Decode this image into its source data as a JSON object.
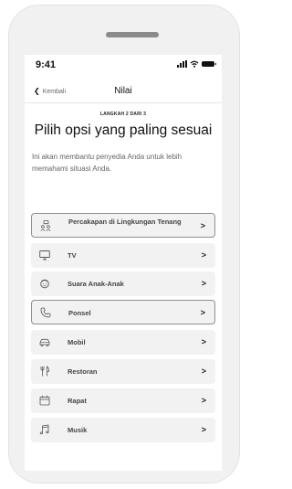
{
  "status": {
    "time": "9:41"
  },
  "nav": {
    "back_label": "Kembali",
    "title": "Nilai"
  },
  "step_label": "LANGKAH 2 DARI 3",
  "headline": "Pilih opsi yang paling sesuai",
  "subtitle": "Ini akan membantu penyedia Anda untuk lebih memahami situasi Anda.",
  "options": [
    {
      "label": "Percakapan di Lingkungan Tenang",
      "icon": "quiet-conversation-icon",
      "selected": true
    },
    {
      "label": "TV",
      "icon": "tv-icon",
      "selected": false
    },
    {
      "label": "Suara Anak-Anak",
      "icon": "child-icon",
      "selected": false
    },
    {
      "label": "Ponsel",
      "icon": "phone-icon",
      "selected": true
    },
    {
      "label": "Mobil",
      "icon": "car-icon",
      "selected": false
    },
    {
      "label": "Restoran",
      "icon": "restaurant-icon",
      "selected": false
    },
    {
      "label": "Rapat",
      "icon": "calendar-icon",
      "selected": false
    },
    {
      "label": "Musik",
      "icon": "music-icon",
      "selected": false
    }
  ]
}
